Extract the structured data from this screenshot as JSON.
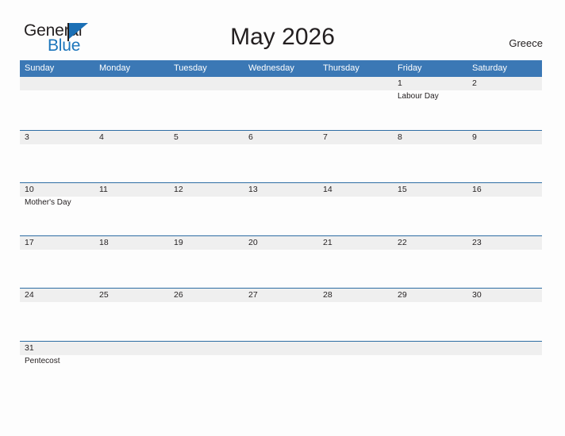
{
  "brand": {
    "name_part1": "General",
    "name_part2": "Blue",
    "flag_icon": "flag-triangle-icon"
  },
  "header": {
    "title": "May 2026",
    "region": "Greece"
  },
  "colors": {
    "header_blue": "#3b78b5",
    "row_border_blue": "#2e6da4",
    "band_gray": "#efefef",
    "brand_blue": "#1b75bb",
    "text": "#231f20",
    "page_background": "#fdfdfd"
  },
  "calendar": {
    "day_headers": [
      "Sunday",
      "Monday",
      "Tuesday",
      "Wednesday",
      "Thursday",
      "Friday",
      "Saturday"
    ],
    "weeks": [
      [
        {
          "date": "",
          "events": []
        },
        {
          "date": "",
          "events": []
        },
        {
          "date": "",
          "events": []
        },
        {
          "date": "",
          "events": []
        },
        {
          "date": "",
          "events": []
        },
        {
          "date": "1",
          "events": [
            "Labour Day"
          ]
        },
        {
          "date": "2",
          "events": []
        }
      ],
      [
        {
          "date": "3",
          "events": []
        },
        {
          "date": "4",
          "events": []
        },
        {
          "date": "5",
          "events": []
        },
        {
          "date": "6",
          "events": []
        },
        {
          "date": "7",
          "events": []
        },
        {
          "date": "8",
          "events": []
        },
        {
          "date": "9",
          "events": []
        }
      ],
      [
        {
          "date": "10",
          "events": [
            "Mother's Day"
          ]
        },
        {
          "date": "11",
          "events": []
        },
        {
          "date": "12",
          "events": []
        },
        {
          "date": "13",
          "events": []
        },
        {
          "date": "14",
          "events": []
        },
        {
          "date": "15",
          "events": []
        },
        {
          "date": "16",
          "events": []
        }
      ],
      [
        {
          "date": "17",
          "events": []
        },
        {
          "date": "18",
          "events": []
        },
        {
          "date": "19",
          "events": []
        },
        {
          "date": "20",
          "events": []
        },
        {
          "date": "21",
          "events": []
        },
        {
          "date": "22",
          "events": []
        },
        {
          "date": "23",
          "events": []
        }
      ],
      [
        {
          "date": "24",
          "events": []
        },
        {
          "date": "25",
          "events": []
        },
        {
          "date": "26",
          "events": []
        },
        {
          "date": "27",
          "events": []
        },
        {
          "date": "28",
          "events": []
        },
        {
          "date": "29",
          "events": []
        },
        {
          "date": "30",
          "events": []
        }
      ],
      [
        {
          "date": "31",
          "events": [
            "Pentecost"
          ]
        },
        {
          "date": "",
          "events": []
        },
        {
          "date": "",
          "events": []
        },
        {
          "date": "",
          "events": []
        },
        {
          "date": "",
          "events": []
        },
        {
          "date": "",
          "events": []
        },
        {
          "date": "",
          "events": []
        }
      ]
    ]
  }
}
